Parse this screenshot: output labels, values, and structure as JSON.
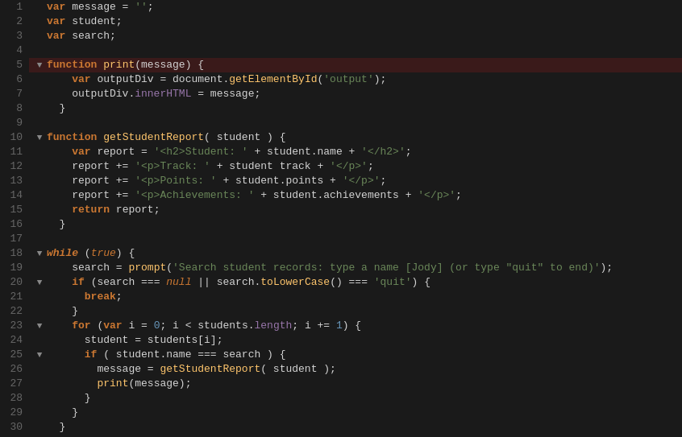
{
  "editor": {
    "background": "#1a1a1a",
    "highlight_line": 5,
    "lines": [
      {
        "num": 1,
        "gutter": "",
        "content": "var_message_eq_empty_str"
      },
      {
        "num": 2,
        "gutter": "",
        "content": "var_student"
      },
      {
        "num": 3,
        "gutter": "",
        "content": "var_search"
      },
      {
        "num": 4,
        "gutter": "",
        "content": ""
      },
      {
        "num": 5,
        "gutter": "collapse",
        "content": "function_print_highlighted"
      },
      {
        "num": 6,
        "gutter": "",
        "content": "var_outputDiv"
      },
      {
        "num": 7,
        "gutter": "",
        "content": "outputDiv_innerHTML"
      },
      {
        "num": 8,
        "gutter": "",
        "content": "close_brace"
      },
      {
        "num": 9,
        "gutter": "",
        "content": ""
      },
      {
        "num": 10,
        "gutter": "collapse",
        "content": "function_getStudentReport"
      },
      {
        "num": 11,
        "gutter": "",
        "content": "var_report_h2"
      },
      {
        "num": 12,
        "gutter": "",
        "content": "report_track"
      },
      {
        "num": 13,
        "gutter": "",
        "content": "report_points"
      },
      {
        "num": 14,
        "gutter": "",
        "content": "report_achievements"
      },
      {
        "num": 15,
        "gutter": "",
        "content": "return_report"
      },
      {
        "num": 16,
        "gutter": "",
        "content": "close_brace2"
      },
      {
        "num": 17,
        "gutter": "",
        "content": ""
      },
      {
        "num": 18,
        "gutter": "collapse",
        "content": "while_true"
      },
      {
        "num": 19,
        "gutter": "",
        "content": "search_prompt"
      },
      {
        "num": 20,
        "gutter": "collapse",
        "content": "if_search_null"
      },
      {
        "num": 21,
        "gutter": "",
        "content": "break"
      },
      {
        "num": 22,
        "gutter": "",
        "content": "close_brace3"
      },
      {
        "num": 23,
        "gutter": "collapse",
        "content": "for_loop"
      },
      {
        "num": 24,
        "gutter": "",
        "content": "student_eq_students_i"
      },
      {
        "num": 25,
        "gutter": "collapse",
        "content": "if_student_name"
      },
      {
        "num": 26,
        "gutter": "",
        "content": "message_eq_report"
      },
      {
        "num": 27,
        "gutter": "",
        "content": "print_message"
      },
      {
        "num": 28,
        "gutter": "",
        "content": "close_brace4"
      },
      {
        "num": 29,
        "gutter": "",
        "content": "close_brace5"
      },
      {
        "num": 30,
        "gutter": "",
        "content": "close_brace6"
      }
    ]
  }
}
